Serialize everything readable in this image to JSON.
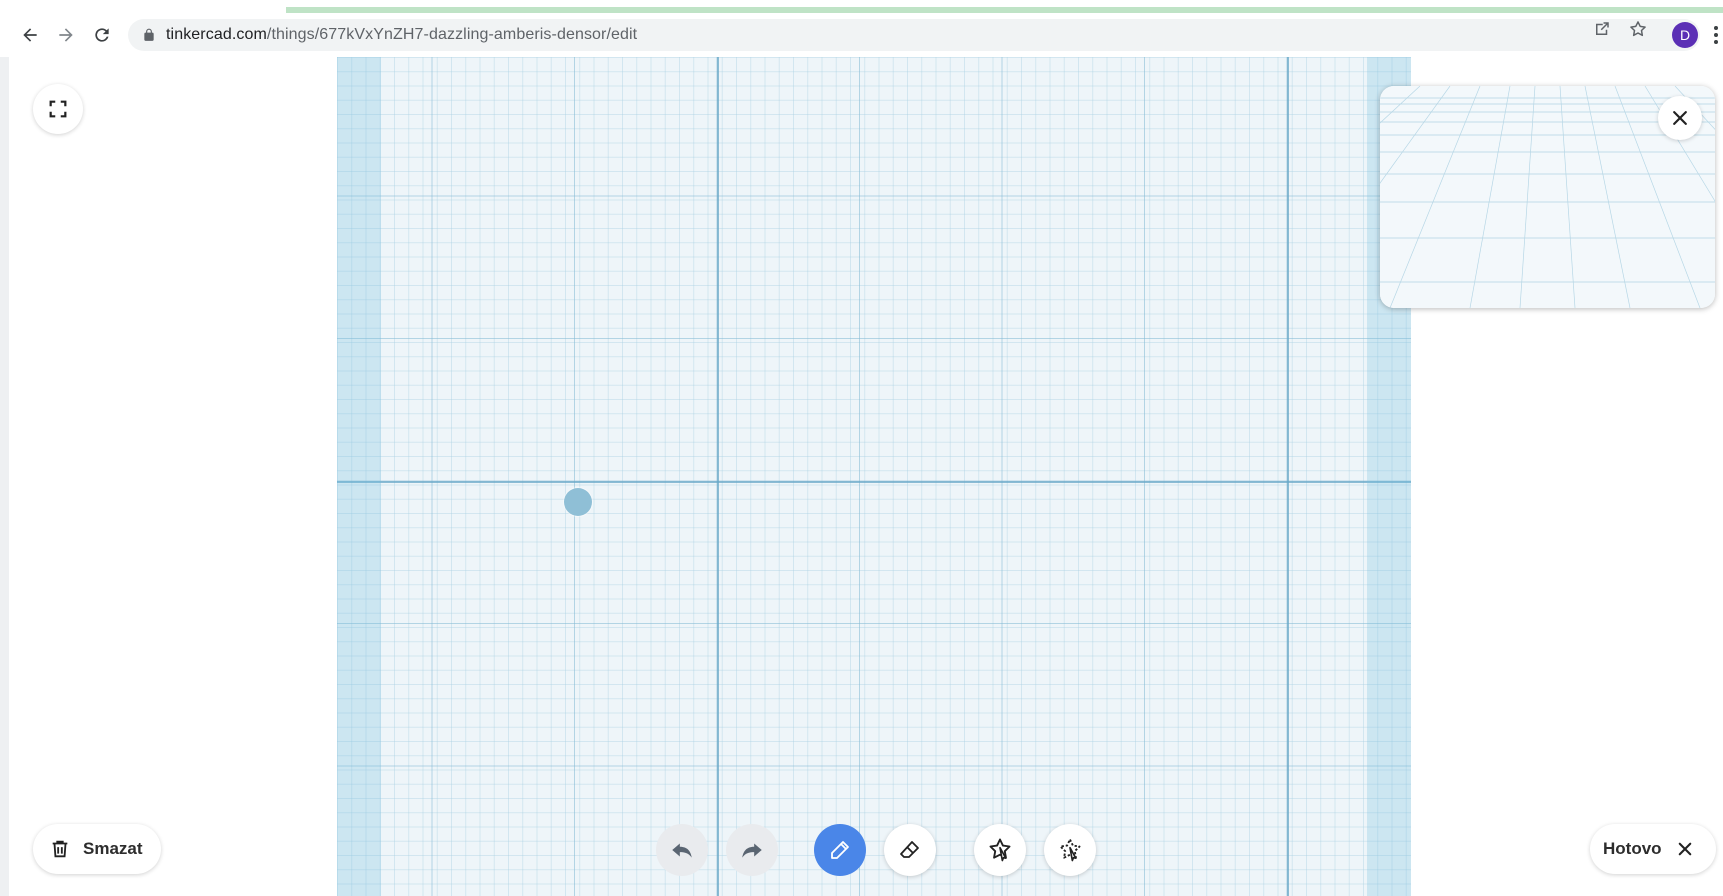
{
  "browser": {
    "url_host": "tinkercad.com",
    "url_path": "/things/677kVxYnZH7-dazzling-amberis-densor/edit",
    "avatar_initial": "D",
    "accent_color": "#5b2fb5"
  },
  "editor": {
    "fullscreen_icon": "fullscreen-icon",
    "delete_label": "Smazat",
    "done_label": "Hotovo",
    "active_tool": "pencil",
    "tools": [
      "undo",
      "redo",
      "pencil",
      "eraser",
      "shape-select",
      "shape-deselect"
    ],
    "colors": {
      "active_tool": "#4a86e8",
      "grid_background": "#eef5f9",
      "grid_line": "#68a8c8",
      "point": "#8fbfd6"
    }
  }
}
